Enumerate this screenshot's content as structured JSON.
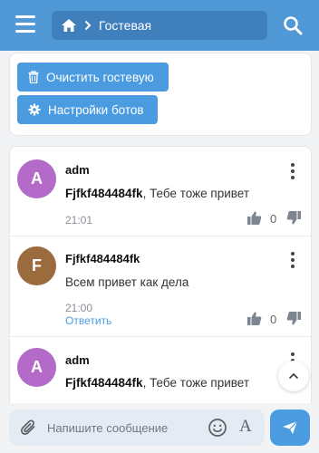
{
  "header": {
    "menu_icon": "hamburger-icon",
    "home_icon": "home-icon",
    "breadcrumb_label": "Гостевая",
    "search_icon": "search-icon",
    "bar_color": "#5098d6"
  },
  "actions": {
    "clear_label": "Очистить гостевую",
    "bots_label": "Настройки ботов",
    "button_color": "#4b9be0"
  },
  "messages": [
    {
      "avatar_letter": "A",
      "avatar_color": "#b36ac9",
      "author": "adm",
      "mention": "Fjfkf484484fk",
      "text": ", Тебе тоже привет",
      "time": "21:01",
      "likes": "0"
    },
    {
      "avatar_letter": "F",
      "avatar_color": "#9a6b3d",
      "author": "Fjfkf484484fk",
      "text": "Всем привет как дела",
      "time": "21:00",
      "reply_label": "Ответить",
      "likes": "0"
    },
    {
      "avatar_letter": "A",
      "avatar_color": "#b36ac9",
      "author": "adm",
      "mention": "Fjfkf484484fk",
      "text": ", Тебе тоже привет"
    }
  ],
  "composer": {
    "placeholder": "Напишите сообщение",
    "format_label": "A",
    "attach_icon": "paperclip-icon",
    "emoji_icon": "smiley-icon",
    "send_icon": "send-icon"
  }
}
